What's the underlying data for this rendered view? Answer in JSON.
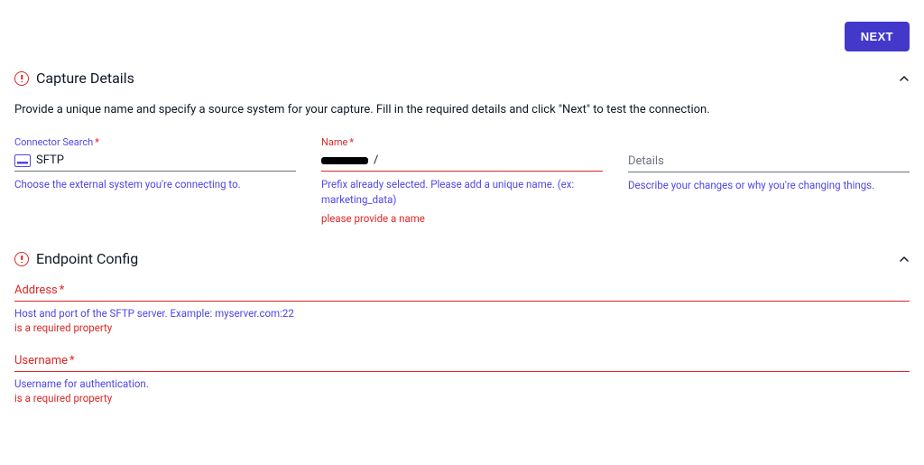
{
  "top": {
    "next": "NEXT"
  },
  "capture": {
    "title": "Capture Details",
    "desc": "Provide a unique name and specify a source system for your capture. Fill in the required details and click \"Next\" to test the connection.",
    "connector": {
      "label": "Connector Search",
      "value": "SFTP",
      "helper": "Choose the external system you're connecting to."
    },
    "name": {
      "label": "Name",
      "suffix": "/",
      "helper": "Prefix already selected. Please add a unique name. (ex: marketing_data)",
      "error": "please provide a name"
    },
    "details": {
      "label": "Details",
      "helper": "Describe your changes or why you're changing things."
    }
  },
  "endpoint": {
    "title": "Endpoint Config",
    "address": {
      "label": "Address",
      "helper": "Host and port of the SFTP server. Example: myserver.com:22",
      "error": "is a required property"
    },
    "username": {
      "label": "Username",
      "helper": "Username for authentication.",
      "error": "is a required property"
    }
  }
}
